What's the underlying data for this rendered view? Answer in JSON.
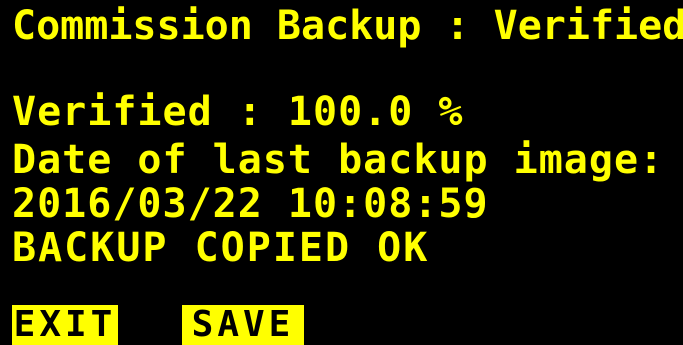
{
  "screen": {
    "title": "Commission Backup : Verified",
    "lines": [
      "Verified : 100.0 %",
      "Date of last backup image:",
      "2016/03/22 10:08:59",
      "BACKUP COPIED OK"
    ]
  },
  "softkeys": {
    "exit_label": "EXIT",
    "save_label": "SAVE"
  },
  "colors": {
    "background": "#000000",
    "text": "#ffff00",
    "softkey_bg": "#ffff00",
    "softkey_text": "#000000"
  }
}
